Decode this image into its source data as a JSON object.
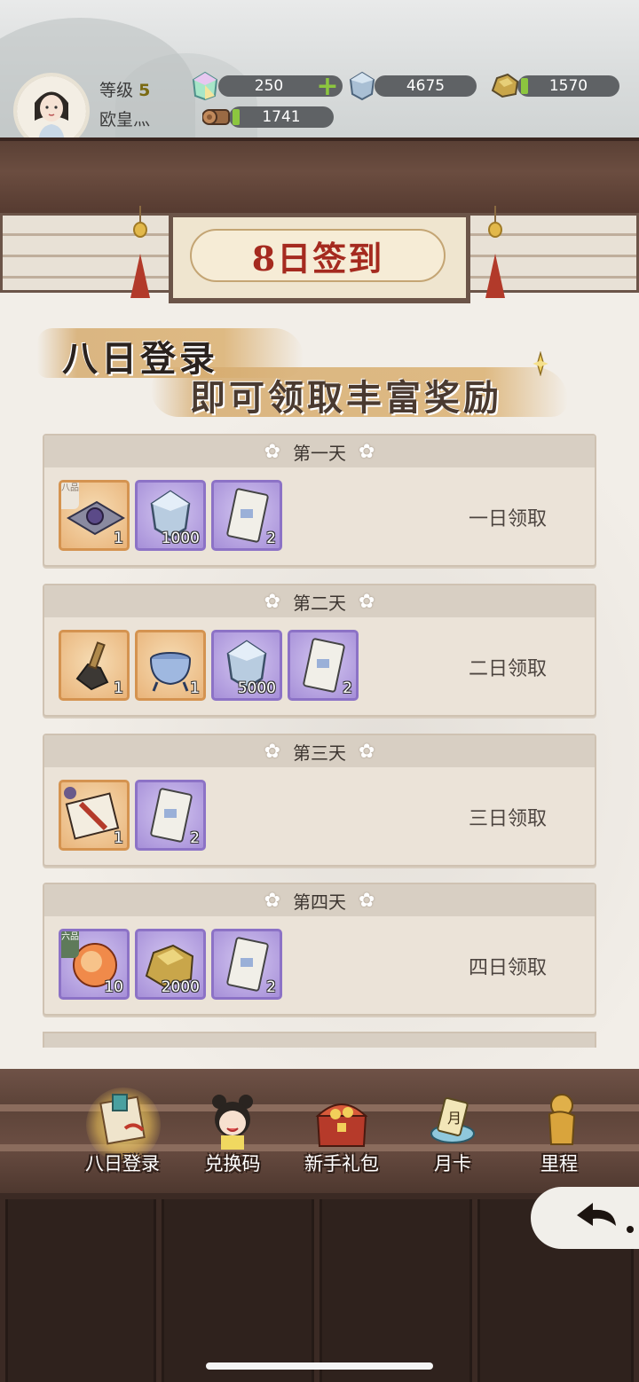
{
  "header": {
    "level_label": "等级",
    "level_value": "5",
    "player_name": "欧皇灬",
    "resources": [
      {
        "name": "jade",
        "icon": "jade-gem-icon",
        "value": "250"
      },
      {
        "name": "silver",
        "icon": "silver-crystal-icon",
        "value": "4675"
      },
      {
        "name": "gold",
        "icon": "gold-ore-icon",
        "value": "1570"
      },
      {
        "name": "wood",
        "icon": "wood-log-icon",
        "value": "1741"
      }
    ]
  },
  "banner": {
    "title": "8日签到",
    "slogan_line1": "八日登录",
    "slogan_line2": "即可领取丰富奖励"
  },
  "days": [
    {
      "title": "第一天",
      "claim_label": "一日领取",
      "items": [
        {
          "icon": "purple-orb-item-icon",
          "frame": "orange",
          "tag": "八品",
          "qty": "1"
        },
        {
          "icon": "silver-crystal-item-icon",
          "frame": "purple",
          "tag": "",
          "qty": "1000"
        },
        {
          "icon": "ticket-item-icon",
          "frame": "purple",
          "tag": "",
          "qty": "2"
        }
      ]
    },
    {
      "title": "第二天",
      "claim_label": "二日领取",
      "items": [
        {
          "icon": "iron-tool-item-icon",
          "frame": "orange",
          "tag": "",
          "qty": "1"
        },
        {
          "icon": "cauldron-item-icon",
          "frame": "orange",
          "tag": "",
          "qty": "1"
        },
        {
          "icon": "silver-crystal-item-icon",
          "frame": "purple",
          "tag": "",
          "qty": "5000"
        },
        {
          "icon": "ticket-item-icon",
          "frame": "purple",
          "tag": "",
          "qty": "2"
        }
      ]
    },
    {
      "title": "第三天",
      "claim_label": "三日领取",
      "items": [
        {
          "icon": "scroll-book-item-icon",
          "frame": "orange",
          "tag": "",
          "qty": "1"
        },
        {
          "icon": "ticket-item-icon",
          "frame": "purple",
          "tag": "",
          "qty": "2"
        }
      ]
    },
    {
      "title": "第四天",
      "claim_label": "四日领取",
      "items": [
        {
          "icon": "fire-orb-item-icon",
          "frame": "purple",
          "tag": "六品",
          "qty": "10"
        },
        {
          "icon": "gold-ore-item-icon",
          "frame": "purple",
          "tag": "",
          "qty": "2000"
        },
        {
          "icon": "ticket-item-icon",
          "frame": "purple",
          "tag": "",
          "qty": "2"
        }
      ]
    }
  ],
  "nav": [
    {
      "label": "八日登录",
      "icon": "scroll-calendar-icon",
      "active": true
    },
    {
      "label": "兑换码",
      "icon": "girl-character-icon",
      "active": false
    },
    {
      "label": "新手礼包",
      "icon": "treasure-chest-icon",
      "active": false
    },
    {
      "label": "月卡",
      "icon": "month-card-icon",
      "active": false
    },
    {
      "label": "里程",
      "icon": "golden-statue-icon",
      "active": false
    }
  ]
}
